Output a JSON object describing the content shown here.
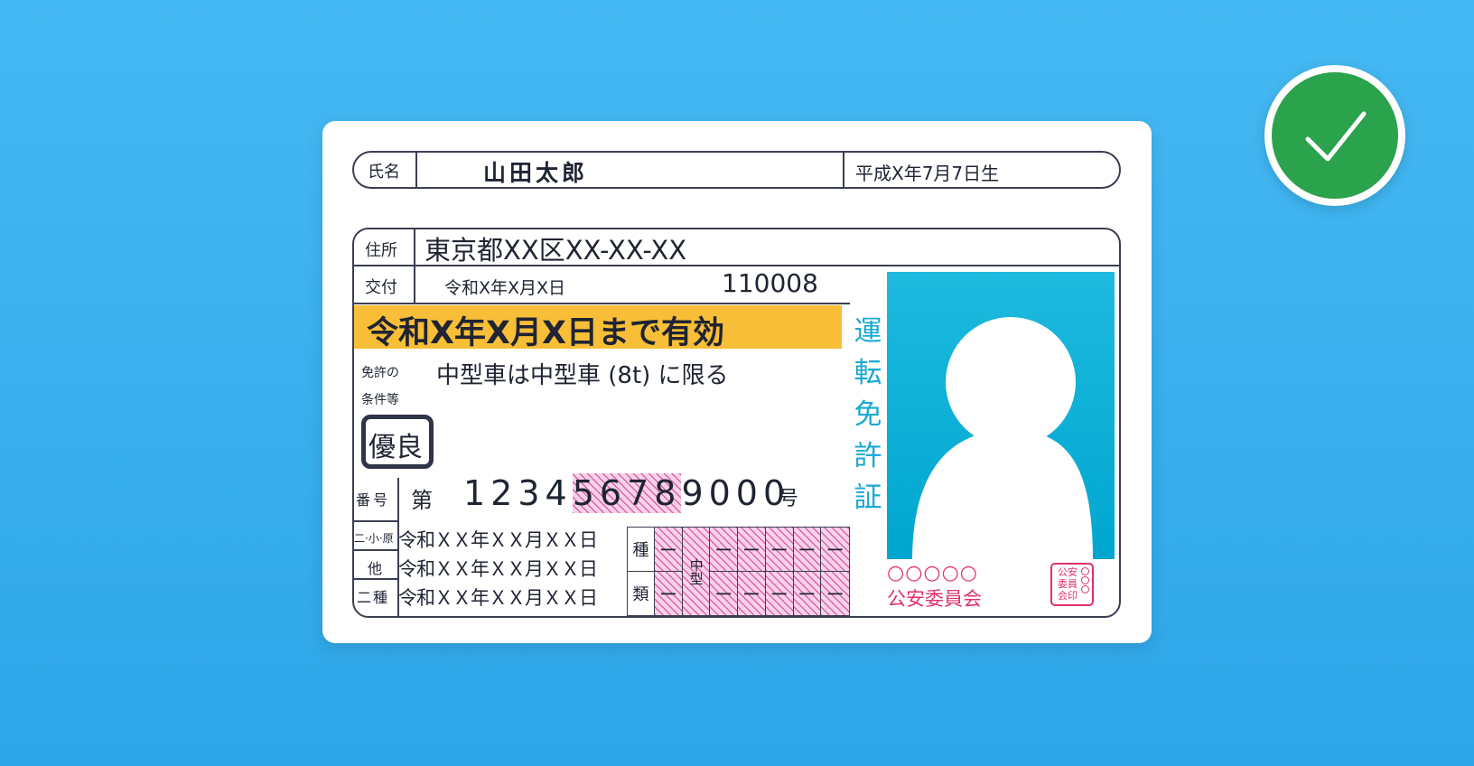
{
  "card": {
    "name_label": "氏名",
    "name_value": "山田太郎",
    "birth_date": "平成X年7月7日生",
    "address_label": "住所",
    "address_value": "東京都XX区XX-XX-XX",
    "issue_label": "交付",
    "issue_date": "令和X年X月X日",
    "issue_number": "110008",
    "validity": "令和X年X月X日まで有効",
    "conditions_label_1": "免許の",
    "conditions_label_2": "条件等",
    "conditions_value": "中型車は中型車 (8t) に限る",
    "excellent_badge": "優良",
    "number_label": "番号",
    "number_prefix": "第",
    "license_number_head": "1234",
    "license_number_highlight": "5678",
    "license_number_tail": "9000",
    "number_suffix": "号",
    "categories": [
      {
        "label": "二·小·原",
        "date": "令和ＸＸ年ＸＸ月ＸＸ日"
      },
      {
        "label": "他",
        "date": "令和ＸＸ年ＸＸ月ＸＸ日"
      },
      {
        "label": "二種",
        "date": "令和ＸＸ年ＸＸ月ＸＸ日"
      }
    ],
    "type_label_1": "種",
    "type_label_2": "類",
    "type_cells_top": [
      "ー",
      "中型",
      "ー",
      "ー",
      "ー",
      "ー",
      "ー"
    ],
    "type_cells_bottom": [
      "ー",
      "",
      "ー",
      "ー",
      "ー",
      "ー",
      "ー"
    ],
    "vertical_title": [
      "運",
      "転",
      "免",
      "許",
      "証"
    ],
    "commission_circles": "○○○○○",
    "commission_name": "公安委員会",
    "seal_text": "公安委員会印"
  },
  "colors": {
    "background": "#3db3f0",
    "validity_bar": "#f9be37",
    "accent_cyan": "#19a9d1",
    "accent_pink": "#e0306f",
    "check_green": "#2ba24c"
  },
  "icons": {
    "verified": "checkmark-icon",
    "photo": "person-silhouette-icon"
  }
}
